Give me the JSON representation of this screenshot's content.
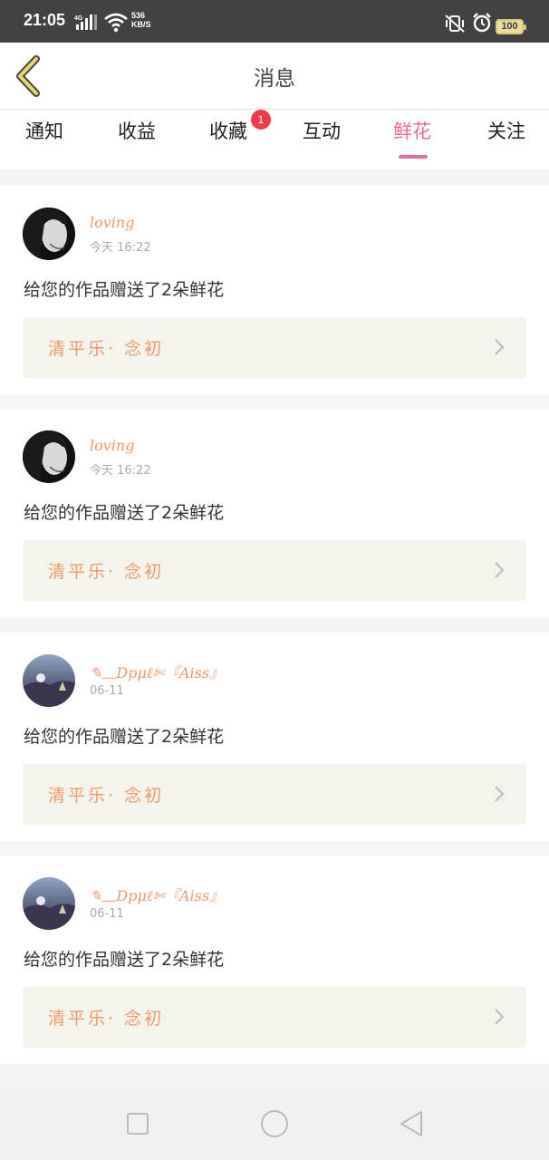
{
  "status_bar": {
    "time": "21:05",
    "net_speed_value": "536",
    "net_speed_unit": "KB/S",
    "battery": "100",
    "icons": [
      "signal-4g-icon",
      "wifi-icon",
      "vibrate-mute-icon",
      "alarm-icon",
      "battery-icon"
    ]
  },
  "header": {
    "title": "消息",
    "back_icon": "chevron-left-icon"
  },
  "tabs": [
    {
      "label": "通知",
      "active": false
    },
    {
      "label": "收益",
      "active": false
    },
    {
      "label": "收藏",
      "active": false,
      "badge": "1"
    },
    {
      "label": "互动",
      "active": false
    },
    {
      "label": "鲜花",
      "active": true
    },
    {
      "label": "关注",
      "active": false
    }
  ],
  "messages": [
    {
      "username": "loving",
      "time": "今天 16:22",
      "text": "给您的作品赠送了2朵鲜花",
      "work_title": "清平乐· 念初",
      "avatar": "avatar-portrait"
    },
    {
      "username": "loving",
      "time": "今天 16:22",
      "text": "给您的作品赠送了2朵鲜花",
      "work_title": "清平乐· 念初",
      "avatar": "avatar-portrait"
    },
    {
      "username": "✎﹏Dpμℓ✄『Aiss』",
      "time": "06-11",
      "text": "给您的作品赠送了2朵鲜花",
      "work_title": "清平乐· 念初",
      "avatar": "avatar-landscape"
    },
    {
      "username": "✎﹏Dpμℓ✄『Aiss』",
      "time": "06-11",
      "text": "给您的作品赠送了2朵鲜花",
      "work_title": "清平乐· 念初",
      "avatar": "avatar-landscape"
    }
  ],
  "nav_bar": {
    "icons": [
      "recent-apps-icon",
      "home-icon",
      "back-icon"
    ]
  },
  "colors": {
    "accent": "#e86b97",
    "username": "#ee9a6b",
    "badge": "#f23b4d",
    "work_bg": "#f4f4ec"
  }
}
